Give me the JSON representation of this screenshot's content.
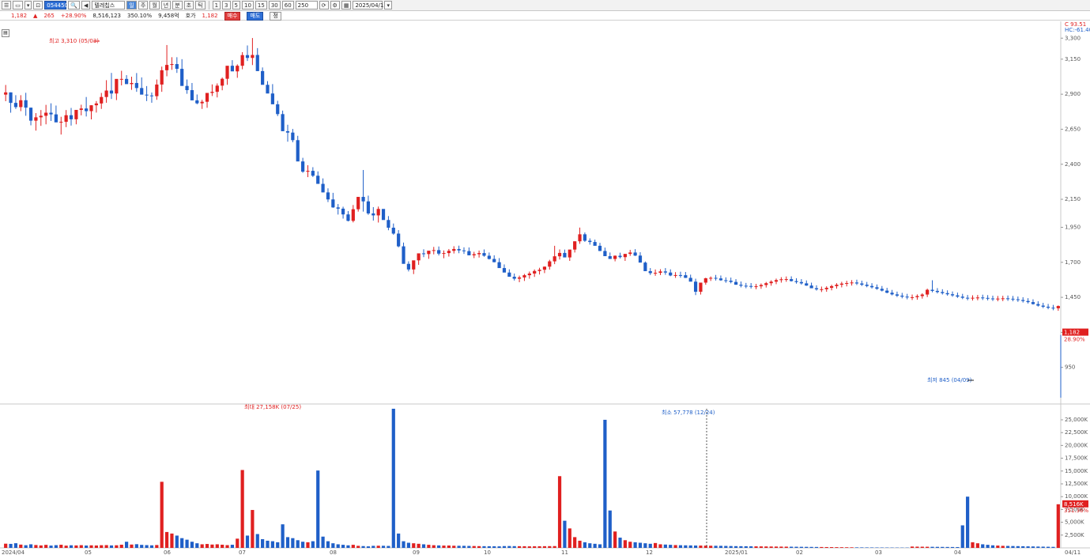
{
  "toolbar": {
    "stock_code": "054450",
    "stock_name": "텔레칩스",
    "period_buttons": [
      "주",
      "월",
      "년",
      "분",
      "초",
      "틱"
    ],
    "interval_buttons": [
      "1",
      "3",
      "5",
      "10",
      "15",
      "30",
      "60"
    ],
    "count_value": "250",
    "date_value": "2025/04/11",
    "settings_icon": "gear-icon"
  },
  "infobar": {
    "price": "1,182",
    "change": "265",
    "change_pct": "+28.90%",
    "volume": "8,516,123",
    "volume_ratio": "350.10%",
    "amount": "9,458억",
    "label_cap": "호가",
    "price2": "1,182",
    "btn_buy": "매수",
    "btn_sell": "매도",
    "btn_other": "정"
  },
  "price_panel": {
    "max_label": "최고 3,310 (05/03)",
    "min_label": "최저 845 (04/09)",
    "ma_labels": [
      "C 93.51",
      "HC:-61.40"
    ],
    "current_tag_price": "1,182",
    "current_tag_pct": "28.90%"
  },
  "volume_panel": {
    "max_label": "최대 27,158K (07/25)",
    "min_label": "최소 57,778 (12/24)",
    "current_tag_vol": "8,516K",
    "current_tag_pct": "351.36%"
  },
  "colors": {
    "up": "#e02020",
    "down": "#1f5fc8",
    "axis_text": "#555555",
    "grid": "#e9e9e9"
  },
  "chart_data": {
    "type": "candlestick",
    "price_axis_ticks": [
      "3,300",
      "3,150",
      "2,900",
      "2,650",
      "2,400",
      "2,150",
      "1,950",
      "1,700",
      "1,450",
      "1,200",
      "950"
    ],
    "volume_axis_ticks": [
      "25,000K",
      "22,500K",
      "20,000K",
      "17,500K",
      "15,000K",
      "12,500K",
      "10,000K",
      "7,500K",
      "5,000K",
      "2,500K"
    ],
    "x_axis_labels": [
      "2024/04",
      "05",
      "06",
      "07",
      "08",
      "09",
      "10",
      "11",
      "12",
      "2025/01",
      "02",
      "03",
      "04"
    ],
    "last_date_label": "04/11",
    "y_price_range": [
      700,
      3420
    ],
    "y_volume_range": [
      0,
      27158
    ],
    "candles_ohlc": [
      [
        2897,
        2966,
        2850,
        2913
      ],
      [
        2913,
        2913,
        2768,
        2838
      ],
      [
        2838,
        2893,
        2795,
        2808
      ],
      [
        2808,
        2893,
        2779,
        2857
      ],
      [
        2857,
        2910,
        2746,
        2804
      ],
      [
        2804,
        2804,
        2678,
        2711
      ],
      [
        2711,
        2765,
        2640,
        2735
      ],
      [
        2735,
        2787,
        2674,
        2746
      ],
      [
        2746,
        2824,
        2685,
        2768
      ],
      [
        2768,
        2835,
        2709,
        2756
      ],
      [
        2756,
        2819,
        2716,
        2699
      ],
      [
        2699,
        2739,
        2612,
        2703
      ],
      [
        2703,
        2787,
        2665,
        2750
      ],
      [
        2750,
        2802,
        2676,
        2721
      ],
      [
        2721,
        2770,
        2685,
        2788
      ],
      [
        2788,
        2825,
        2749,
        2798
      ],
      [
        2798,
        2880,
        2741,
        2779
      ],
      [
        2779,
        2821,
        2720,
        2821
      ],
      [
        2821,
        2851,
        2769,
        2834
      ],
      [
        2834,
        2909,
        2795,
        2880
      ],
      [
        2880,
        3000,
        2839,
        2926
      ],
      [
        2926,
        3052,
        2866,
        2905
      ],
      [
        2905,
        2999,
        2858,
        3009
      ],
      [
        3009,
        3067,
        2963,
        3009
      ],
      [
        3009,
        3036,
        2990,
        2972
      ],
      [
        2972,
        3025,
        2931,
        2980
      ],
      [
        2980,
        3051,
        2917,
        2944
      ],
      [
        2944,
        3020,
        2919,
        2897
      ],
      [
        2897,
        2958,
        2851,
        2891
      ],
      [
        2891,
        2912,
        2839,
        2886
      ],
      [
        2886,
        3005,
        2860,
        2969
      ],
      [
        2969,
        3097,
        2917,
        3071
      ],
      [
        3071,
        3251,
        3028,
        3109
      ],
      [
        3109,
        3164,
        3074,
        3115
      ],
      [
        3115,
        3164,
        3052,
        3081
      ],
      [
        3081,
        3150,
        2979,
        2959
      ],
      [
        2959,
        3005,
        2903,
        2929
      ],
      [
        2929,
        2980,
        2872,
        2856
      ],
      [
        2856,
        2898,
        2828,
        2835
      ],
      [
        2835,
        2860,
        2795,
        2846
      ],
      [
        2846,
        2889,
        2803,
        2909
      ],
      [
        2909,
        2970,
        2887,
        2917
      ],
      [
        2917,
        2977,
        2877,
        2961
      ],
      [
        2961,
        3019,
        2928,
        3010
      ],
      [
        3010,
        3091,
        2967,
        3103
      ],
      [
        3103,
        3143,
        3069,
        3063
      ],
      [
        3063,
        3113,
        3017,
        3103
      ],
      [
        3103,
        3200,
        3078,
        3179
      ],
      [
        3179,
        3248,
        3137,
        3159
      ],
      [
        3159,
        3301,
        3108,
        3180
      ],
      [
        3180,
        3229,
        3066,
        3065
      ],
      [
        3065,
        3091,
        2985,
        2967
      ],
      [
        2967,
        2993,
        2911,
        2905
      ],
      [
        2905,
        2972,
        2838,
        2828
      ],
      [
        2828,
        2853,
        2744,
        2758
      ],
      [
        2758,
        2783,
        2662,
        2636
      ],
      [
        2636,
        2682,
        2561,
        2626
      ],
      [
        2626,
        2652,
        2557,
        2572
      ],
      [
        2572,
        2603,
        2442,
        2420
      ],
      [
        2420,
        2446,
        2339,
        2347
      ],
      [
        2347,
        2393,
        2308,
        2353
      ],
      [
        2353,
        2379,
        2309,
        2318
      ],
      [
        2318,
        2349,
        2261,
        2260
      ],
      [
        2260,
        2299,
        2200,
        2199
      ],
      [
        2199,
        2228,
        2130,
        2149
      ],
      [
        2149,
        2196,
        2089,
        2092
      ],
      [
        2092,
        2116,
        2041,
        2083
      ],
      [
        2083,
        2097,
        2012,
        2042
      ],
      [
        2042,
        2066,
        1992,
        1996
      ],
      [
        1996,
        2109,
        1985,
        2079
      ],
      [
        2079,
        2135,
        2062,
        2167
      ],
      [
        2167,
        2359,
        2062,
        2135
      ],
      [
        2135,
        2176,
        2039,
        2049
      ],
      [
        2049,
        2094,
        1998,
        2035
      ],
      [
        2035,
        2098,
        1984,
        2081
      ],
      [
        2081,
        2080,
        2014,
        2002
      ],
      [
        2002,
        2030,
        1929,
        1947
      ],
      [
        1947,
        1977,
        1897,
        1905
      ],
      [
        1905,
        1930,
        1807,
        1814
      ],
      [
        1814,
        1841,
        1701,
        1689
      ],
      [
        1689,
        1707,
        1635,
        1649
      ],
      [
        1649,
        1713,
        1616,
        1714
      ],
      [
        1714,
        1744,
        1682,
        1764
      ],
      [
        1764,
        1793,
        1737,
        1759
      ],
      [
        1759,
        1780,
        1725,
        1783
      ],
      [
        1783,
        1810,
        1757,
        1787
      ],
      [
        1787,
        1813,
        1749,
        1762
      ],
      [
        1762,
        1785,
        1729,
        1766
      ],
      [
        1766,
        1795,
        1741,
        1782
      ],
      [
        1782,
        1815,
        1763,
        1795
      ],
      [
        1795,
        1819,
        1765,
        1785
      ],
      [
        1785,
        1807,
        1760,
        1780
      ],
      [
        1780,
        1806,
        1750,
        1750
      ],
      [
        1750,
        1775,
        1730,
        1758
      ],
      [
        1758,
        1784,
        1734,
        1766
      ],
      [
        1766,
        1792,
        1740,
        1747
      ],
      [
        1747,
        1770,
        1720,
        1724
      ],
      [
        1724,
        1750,
        1700,
        1701
      ],
      [
        1701,
        1730,
        1672,
        1659
      ],
      [
        1659,
        1685,
        1630,
        1627
      ],
      [
        1627,
        1650,
        1601,
        1597
      ],
      [
        1597,
        1620,
        1570,
        1583
      ],
      [
        1583,
        1605,
        1558,
        1592
      ],
      [
        1592,
        1617,
        1567,
        1608
      ],
      [
        1608,
        1634,
        1583,
        1620
      ],
      [
        1620,
        1649,
        1596,
        1638
      ],
      [
        1638,
        1661,
        1613,
        1647
      ],
      [
        1647,
        1670,
        1623,
        1669
      ],
      [
        1669,
        1718,
        1648,
        1707
      ],
      [
        1707,
        1818,
        1687,
        1743
      ],
      [
        1743,
        1792,
        1720,
        1767
      ],
      [
        1767,
        1791,
        1738,
        1735
      ],
      [
        1735,
        1770,
        1710,
        1791
      ],
      [
        1791,
        1850,
        1770,
        1850
      ],
      [
        1850,
        1948,
        1832,
        1900
      ],
      [
        1900,
        1913,
        1846,
        1854
      ],
      [
        1854,
        1871,
        1826,
        1845
      ],
      [
        1845,
        1862,
        1820,
        1818
      ],
      [
        1818,
        1839,
        1780,
        1781
      ],
      [
        1781,
        1805,
        1750,
        1744
      ],
      [
        1744,
        1770,
        1725,
        1724
      ],
      [
        1724,
        1749,
        1707,
        1747
      ],
      [
        1747,
        1769,
        1728,
        1737
      ],
      [
        1737,
        1759,
        1710,
        1760
      ],
      [
        1760,
        1789,
        1746,
        1770
      ],
      [
        1770,
        1794,
        1745,
        1748
      ],
      [
        1748,
        1772,
        1708,
        1698
      ],
      [
        1698,
        1706,
        1643,
        1637
      ],
      [
        1637,
        1659,
        1610,
        1623
      ],
      [
        1623,
        1649,
        1604,
        1625
      ],
      [
        1625,
        1651,
        1609,
        1635
      ],
      [
        1635,
        1659,
        1611,
        1627
      ],
      [
        1627,
        1650,
        1601,
        1606
      ],
      [
        1606,
        1630,
        1589,
        1609
      ],
      [
        1609,
        1633,
        1590,
        1608
      ],
      [
        1608,
        1631,
        1588,
        1589
      ],
      [
        1589,
        1612,
        1570,
        1562
      ],
      [
        1562,
        1583,
        1466,
        1490
      ],
      [
        1490,
        1553,
        1470,
        1555
      ],
      [
        1555,
        1590,
        1540,
        1586
      ],
      [
        1586,
        1599,
        1567,
        1589
      ],
      [
        1589,
        1610,
        1570,
        1585
      ],
      [
        1585,
        1606,
        1568,
        1572
      ],
      [
        1572,
        1593,
        1554,
        1569
      ],
      [
        1569,
        1591,
        1550,
        1560
      ],
      [
        1560,
        1580,
        1540,
        1540
      ],
      [
        1540,
        1563,
        1521,
        1533
      ],
      [
        1533,
        1553,
        1515,
        1531
      ],
      [
        1531,
        1552,
        1513,
        1526
      ],
      [
        1526,
        1546,
        1508,
        1529
      ],
      [
        1529,
        1549,
        1511,
        1538
      ],
      [
        1538,
        1560,
        1520,
        1551
      ],
      [
        1551,
        1572,
        1533,
        1562
      ],
      [
        1562,
        1584,
        1544,
        1573
      ],
      [
        1573,
        1594,
        1555,
        1579
      ],
      [
        1579,
        1599,
        1561,
        1580
      ],
      [
        1580,
        1600,
        1563,
        1566
      ],
      [
        1566,
        1587,
        1548,
        1559
      ],
      [
        1559,
        1580,
        1541,
        1550
      ],
      [
        1550,
        1571,
        1532,
        1534
      ],
      [
        1534,
        1555,
        1516,
        1515
      ],
      [
        1515,
        1536,
        1498,
        1507
      ],
      [
        1507,
        1527,
        1488,
        1508
      ],
      [
        1508,
        1529,
        1490,
        1518
      ],
      [
        1518,
        1540,
        1500,
        1530
      ],
      [
        1530,
        1551,
        1512,
        1540
      ],
      [
        1540,
        1561,
        1521,
        1548
      ],
      [
        1548,
        1568,
        1528,
        1552
      ],
      [
        1552,
        1573,
        1534,
        1556
      ],
      [
        1556,
        1576,
        1538,
        1549
      ],
      [
        1549,
        1569,
        1531,
        1540
      ],
      [
        1540,
        1560,
        1522,
        1531
      ],
      [
        1531,
        1551,
        1513,
        1522
      ],
      [
        1522,
        1542,
        1504,
        1511
      ],
      [
        1511,
        1531,
        1492,
        1498
      ],
      [
        1498,
        1518,
        1479,
        1483
      ],
      [
        1483,
        1503,
        1464,
        1471
      ],
      [
        1471,
        1491,
        1452,
        1462
      ],
      [
        1462,
        1482,
        1443,
        1455
      ],
      [
        1455,
        1475,
        1436,
        1450
      ],
      [
        1450,
        1470,
        1431,
        1451
      ],
      [
        1451,
        1471,
        1433,
        1459
      ],
      [
        1459,
        1479,
        1441,
        1470
      ],
      [
        1470,
        1512,
        1452,
        1504
      ],
      [
        1504,
        1572,
        1486,
        1496
      ],
      [
        1496,
        1516,
        1478,
        1488
      ],
      [
        1488,
        1508,
        1470,
        1480
      ],
      [
        1480,
        1500,
        1462,
        1472
      ],
      [
        1472,
        1492,
        1454,
        1464
      ],
      [
        1464,
        1484,
        1446,
        1455
      ],
      [
        1455,
        1475,
        1437,
        1447
      ],
      [
        1447,
        1467,
        1429,
        1445
      ],
      [
        1445,
        1465,
        1427,
        1447
      ],
      [
        1447,
        1467,
        1429,
        1449
      ],
      [
        1449,
        1469,
        1431,
        1446
      ],
      [
        1446,
        1466,
        1428,
        1442
      ],
      [
        1442,
        1462,
        1424,
        1440
      ],
      [
        1440,
        1460,
        1422,
        1441
      ],
      [
        1441,
        1461,
        1423,
        1443
      ],
      [
        1443,
        1463,
        1425,
        1440
      ],
      [
        1440,
        1460,
        1422,
        1436
      ],
      [
        1436,
        1456,
        1418,
        1431
      ],
      [
        1431,
        1451,
        1413,
        1424
      ],
      [
        1424,
        1444,
        1406,
        1416
      ],
      [
        1416,
        1436,
        1398,
        1402
      ],
      [
        1402,
        1422,
        1384,
        1391
      ],
      [
        1391,
        1411,
        1373,
        1383
      ],
      [
        1383,
        1403,
        1365,
        1376
      ],
      [
        1376,
        1396,
        1358,
        1372
      ],
      [
        1372,
        1392,
        1354,
        1388
      ]
    ],
    "volumes_k": [
      820,
      780,
      910,
      640,
      520,
      700,
      560,
      480,
      590,
      450,
      530,
      610,
      440,
      510,
      480,
      530,
      460,
      500,
      470,
      520,
      540,
      480,
      510,
      620,
      1200,
      650,
      720,
      590,
      540,
      500,
      560,
      12900,
      3100,
      2800,
      2400,
      1900,
      1600,
      1200,
      900,
      700,
      760,
      650,
      700,
      620,
      540,
      610,
      1800,
      15200,
      2400,
      7400,
      2700,
      1700,
      1400,
      1300,
      1100,
      4600,
      2100,
      1900,
      1500,
      1200,
      1100,
      1300,
      15100,
      2200,
      1300,
      900,
      700,
      600,
      500,
      600,
      400,
      350,
      300,
      400,
      420,
      410,
      380,
      27158,
      2800,
      1300,
      1000,
      900,
      800,
      700,
      600,
      520,
      480,
      450,
      460,
      420,
      410,
      400,
      380,
      360,
      340,
      330,
      320,
      310,
      300,
      350,
      360,
      340,
      330,
      320,
      300,
      310,
      320,
      330,
      340,
      350,
      14000,
      5300,
      3800,
      2100,
      1400,
      1100,
      900,
      800,
      700,
      25000,
      7300,
      3200,
      2000,
      1500,
      1200,
      1100,
      1000,
      900,
      800,
      950,
      700,
      650,
      600,
      550,
      520,
      500,
      480,
      460,
      450,
      440,
      420,
      410,
      400,
      380,
      360,
      340,
      330,
      320,
      310,
      300,
      290,
      280,
      270,
      260,
      250,
      240,
      230,
      220,
      210,
      200,
      190,
      180,
      170,
      160,
      150,
      140,
      130,
      120,
      110,
      100,
      95,
      90,
      85,
      80,
      75,
      70,
      65,
      60,
      58,
      57,
      260,
      240,
      230,
      220,
      210,
      200,
      190,
      180,
      170,
      160,
      4400,
      10000,
      1100,
      900,
      700,
      600,
      500,
      450,
      400,
      380,
      360,
      340,
      320,
      300,
      280,
      260,
      240,
      220,
      200,
      8516
    ]
  }
}
